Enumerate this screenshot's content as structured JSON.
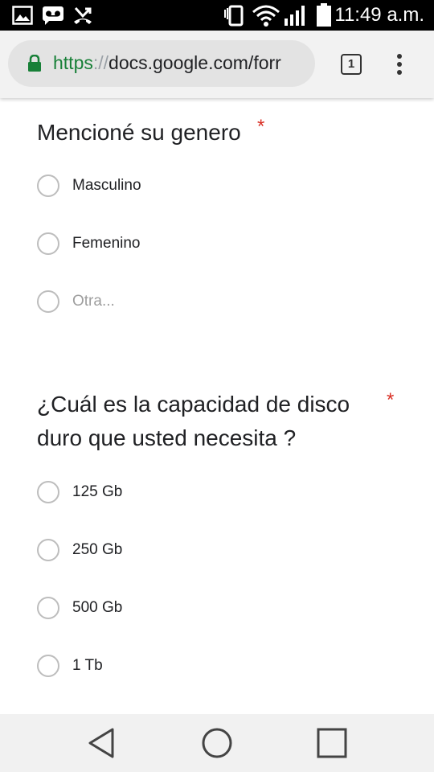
{
  "status_bar": {
    "time": "11:49 a.m.",
    "icons": [
      "image-icon",
      "voicemail-icon",
      "missed-calls-icon",
      "vibrate-icon",
      "wifi-icon",
      "signal-icon",
      "battery-icon"
    ]
  },
  "browser": {
    "url_scheme": "https",
    "url_separator": "://",
    "url_rest": "docs.google.com/forr",
    "tab_count": "1",
    "secure_color": "#188038"
  },
  "form": {
    "questions": [
      {
        "title": "Mencioné su genero",
        "required_mark": "*",
        "options": [
          "Masculino",
          "Femenino"
        ],
        "other_placeholder": "Otra..."
      },
      {
        "title_line1": "¿Cuál es la capacidad de disco",
        "title_line2": "duro que usted necesita ?",
        "required_mark": "*",
        "options": [
          "125 Gb",
          "250 Gb",
          "500 Gb",
          "1 Tb"
        ]
      }
    ],
    "required_color": "#d93025"
  },
  "nav_bar": {
    "buttons": [
      "back-icon",
      "home-icon",
      "recents-icon"
    ]
  }
}
